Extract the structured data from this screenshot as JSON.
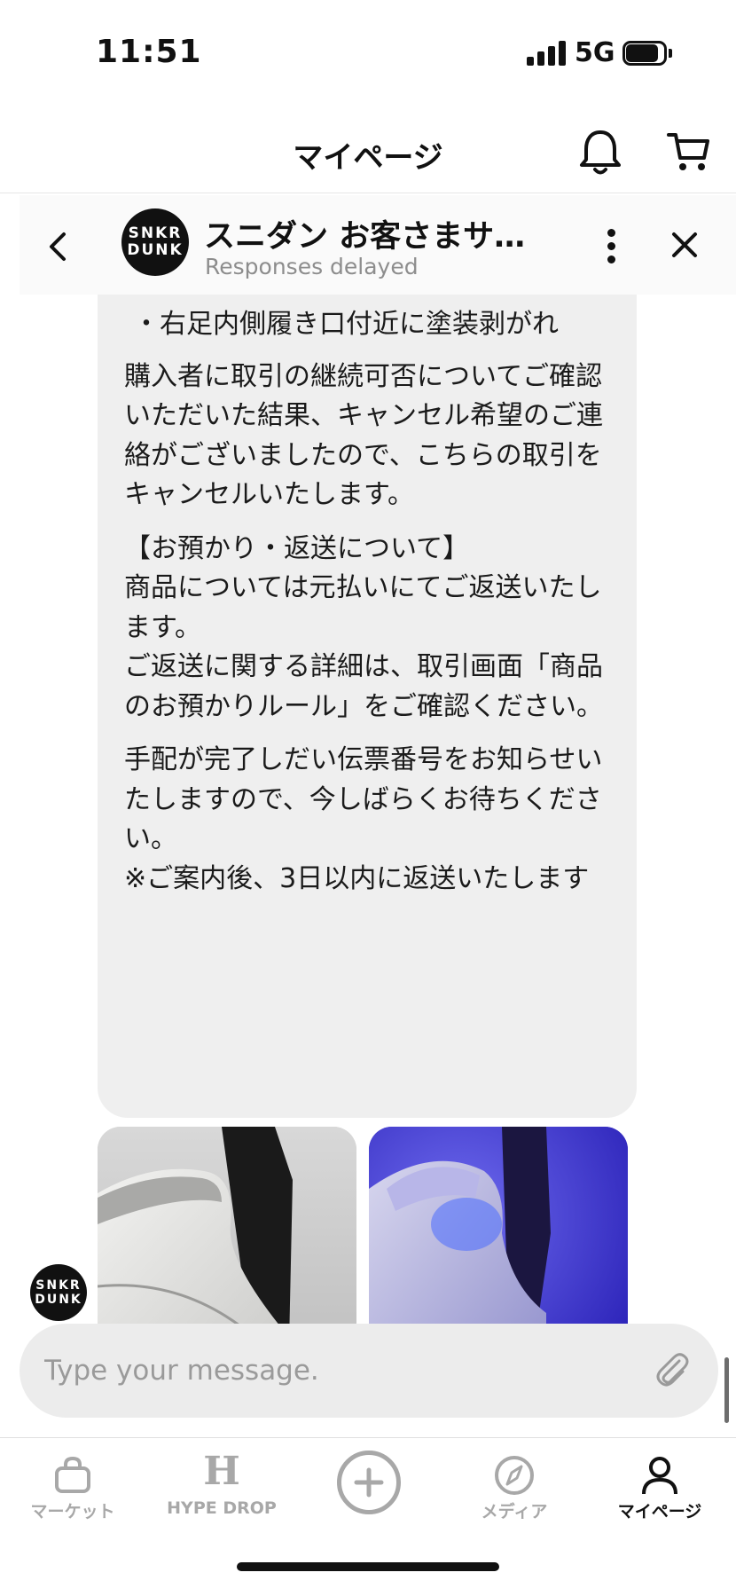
{
  "status_bar": {
    "time": "11:51",
    "network": "5G"
  },
  "header": {
    "title": "マイページ"
  },
  "chat": {
    "avatar_text_line1": "SNKR",
    "avatar_text_line2": "DUNK",
    "name": "スニダン お客さまサ…",
    "status": "Responses delayed",
    "message_paragraphs": [
      "・右足内側履き口付近に塗装剥がれ",
      "購入者に取引の継続可否についてご確認いただいた結果、キャンセル希望のご連絡がございましたので、こちらの取引をキャンセルいたします。",
      "【お預かり・返送について】\n商品については元払いにてご返送いたします。\nご返送に関する詳細は、取引画面「商品のお預かりルール」をご確認ください。",
      "手配が完了しだい伝票番号をお知らせいたしますので、今しばらくお待ちください。\n※ご案内後、3日以内に返送いたします"
    ],
    "input_placeholder": "Type your message."
  },
  "nav": {
    "items": [
      {
        "label": "マーケット",
        "icon": "bag-icon"
      },
      {
        "label": "HYPE DROP",
        "icon": "hype-drop-icon",
        "glyph": "H"
      },
      {
        "label": "",
        "icon": "plus-circle-icon"
      },
      {
        "label": "メディア",
        "icon": "compass-icon"
      },
      {
        "label": "マイページ",
        "icon": "person-icon"
      }
    ],
    "active": "マイページ"
  },
  "colors": {
    "accent": "#111111",
    "inactive": "#a8a8a8",
    "bubble": "#efefef"
  }
}
